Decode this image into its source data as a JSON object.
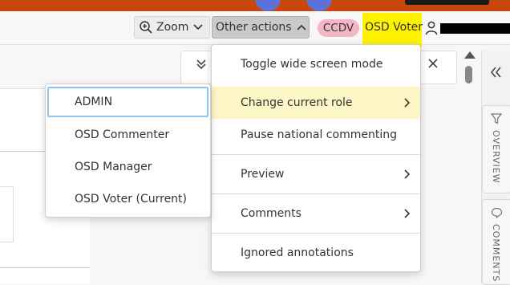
{
  "toolbar": {
    "zoom_label": "Zoom",
    "other_actions_label": "Other actions",
    "role_badge": "CCDV",
    "current_role": "OSD Voter"
  },
  "menu": {
    "items": [
      {
        "label": "Toggle wide screen mode",
        "has_submenu": false
      },
      {
        "label": "Change current role",
        "has_submenu": true,
        "active": true
      },
      {
        "label": "Pause national commenting",
        "has_submenu": false
      },
      {
        "label": "Preview",
        "has_submenu": true
      },
      {
        "label": "Comments",
        "has_submenu": true
      },
      {
        "label": "Ignored annotations",
        "has_submenu": false
      }
    ]
  },
  "role_submenu": {
    "items": [
      {
        "label": "ADMIN",
        "selected": true
      },
      {
        "label": "OSD Commenter"
      },
      {
        "label": "OSD Manager"
      },
      {
        "label": "OSD Voter (Current)"
      }
    ]
  },
  "side_rail": {
    "tabs": [
      "OVERVIEW",
      "COMMENTS"
    ]
  },
  "colors": {
    "top_band": "#c9470c",
    "highlight": "#fff200",
    "role_badge_bg": "#f3b6c6",
    "active_item_bg": "#fdf6c6",
    "focus_ring": "#8ec3ef"
  },
  "icons": [
    "zoom-in-icon",
    "chevron-down-icon",
    "chevron-up-icon",
    "user-icon",
    "double-chevron-down-icon",
    "close-icon",
    "double-chevron-left-icon",
    "filter-icon",
    "comment-icon",
    "chevron-right-icon"
  ]
}
